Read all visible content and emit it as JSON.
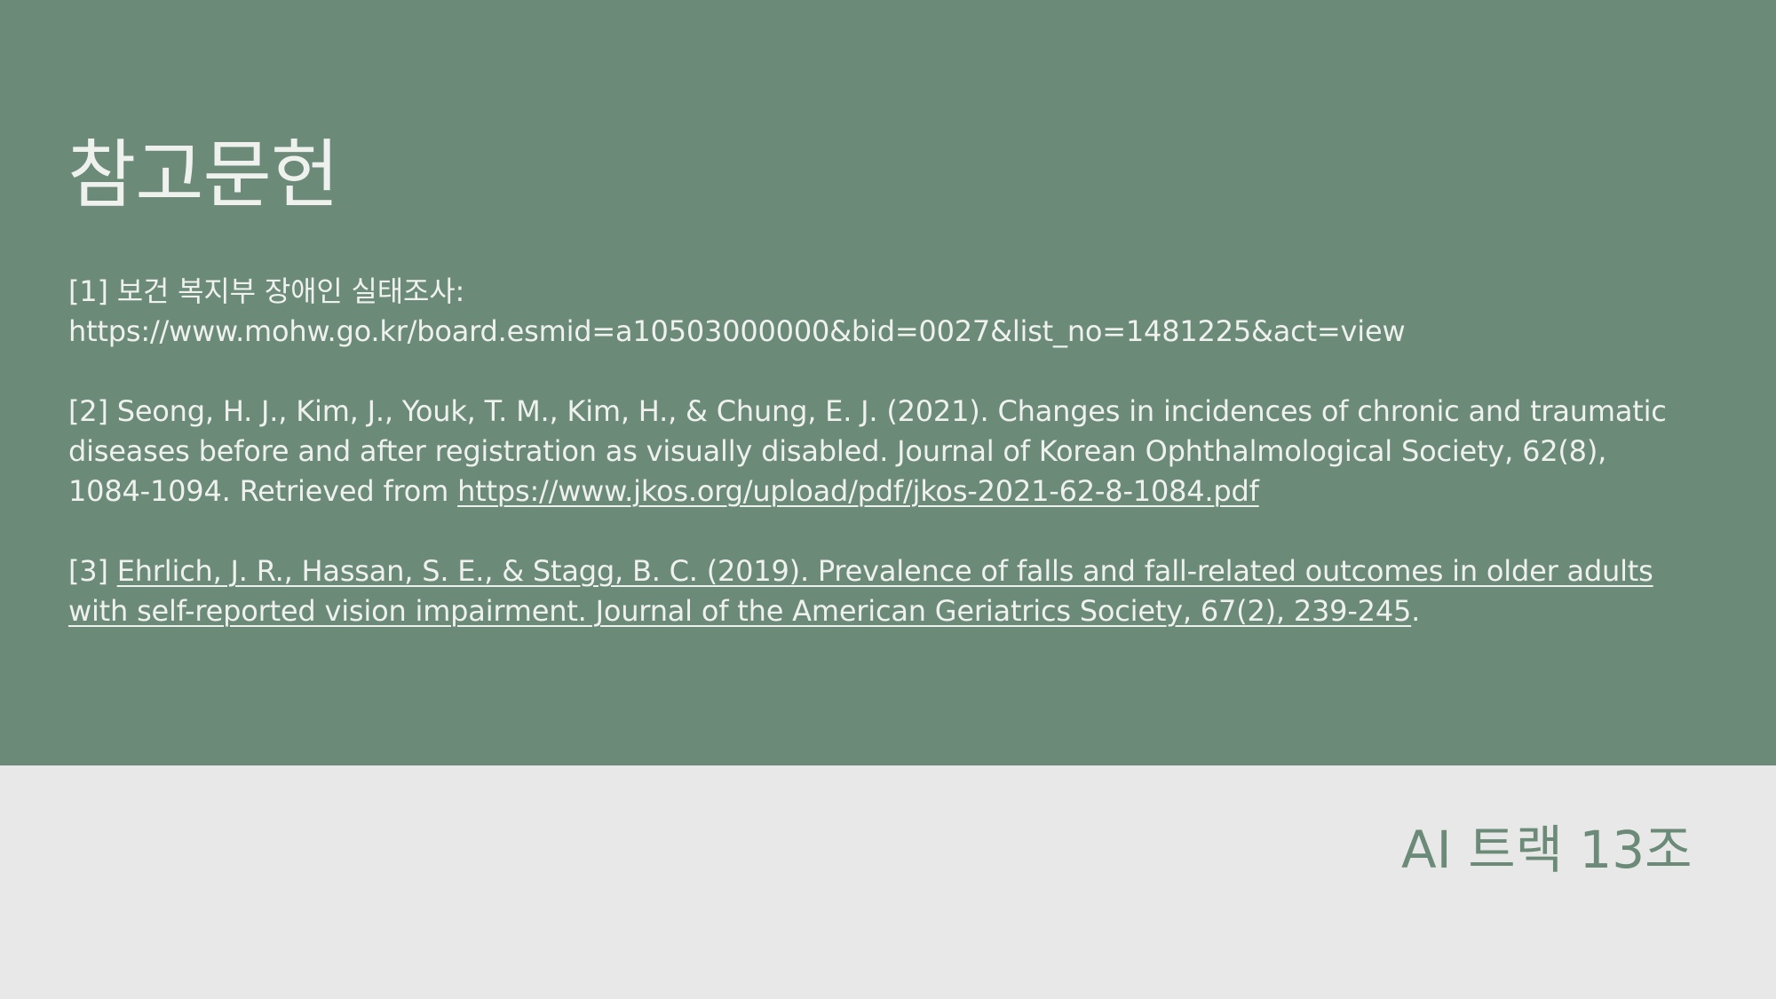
{
  "slide": {
    "title": "참고문헌",
    "footer": "AI 트랙 13조",
    "colors": {
      "top_background": "#6b8a78",
      "bottom_background": "#e8e8e8",
      "text_light": "#eef1ee",
      "accent": "#6b8a78"
    }
  },
  "references": [
    {
      "line1": "[1] 보건 복지부 장애인 실태조사:",
      "line2": "https://www.mohw.go.kr/board.esmid=a10503000000&bid=0027&list_no=1481225&act=view"
    },
    {
      "line1": "[2] Seong, H. J., Kim, J., Youk, T. M., Kim, H., & Chung, E. J. (2021). Changes in incidences of chronic and traumatic",
      "line2": "diseases before and after registration as visually disabled. Journal of Korean Ophthalmological Society, 62(8),",
      "line3_prefix": "1084-1094. Retrieved from ",
      "line3_link": "https://www.jkos.org/upload/pdf/jkos-2021-62-8-1084.pdf"
    },
    {
      "prefix": "[3] ",
      "line1_link": "Ehrlich, J. R., Hassan, S. E., & Stagg, B. C. (2019). Prevalence of falls and fall-related outcomes in older adults",
      "line2_link": "with self-reported vision impairment. Journal of the American Geriatrics Society, 67(2), 239-245",
      "line2_suffix": "."
    }
  ]
}
